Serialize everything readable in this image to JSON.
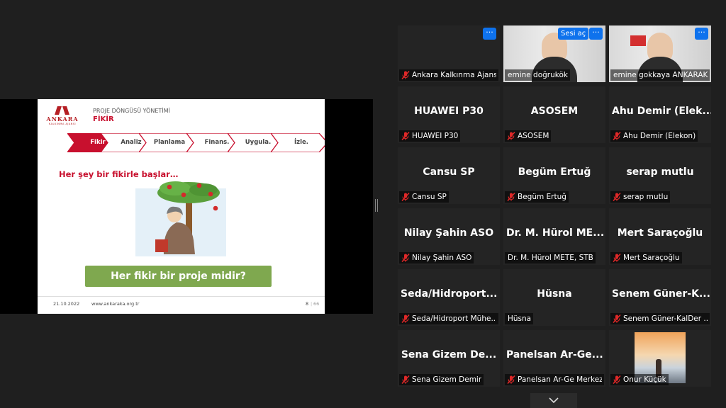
{
  "slide": {
    "logo_name": "ANKARA",
    "logo_sub": "KALKINMA AJANSI",
    "header_title": "PROJE DÖNGÜSÜ YÖNETİMİ",
    "header_subtitle": "FİKİR",
    "steps": [
      "Fikir",
      "Analiz",
      "Planlama",
      "Finans.",
      "Uygula.",
      "İzle."
    ],
    "active_step_index": 0,
    "motto": "Her şey bir fikirle başlar…",
    "question": "Her fikir bir proje midir?",
    "footer_date": "21.10.2022",
    "footer_url": "www.ankaraka.org.tr",
    "page_number": "8",
    "page_total": "66"
  },
  "participants": {
    "unmute_label": "Sesi aç",
    "more_label": "···",
    "tiles": [
      {
        "name": "Ankara Kalkınma Ajansı",
        "big": "",
        "muted": true
      },
      {
        "name": "emine doğrukök",
        "big": "",
        "muted": false,
        "video": "camera"
      },
      {
        "name": "emine gokkaya ANKARAKA",
        "big": "",
        "muted": false,
        "video": "camera",
        "active": true
      },
      {
        "name": "HUAWEI P30",
        "big": "HUAWEI P30",
        "muted": true
      },
      {
        "name": "ASOSEM",
        "big": "ASOSEM",
        "muted": true
      },
      {
        "name": "Ahu Demir (Elekon)",
        "big": "Ahu Demir (Elek...",
        "muted": true
      },
      {
        "name": "Cansu SP",
        "big": "Cansu SP",
        "muted": true
      },
      {
        "name": "Begüm Ertuğ",
        "big": "Begüm Ertuğ",
        "muted": true
      },
      {
        "name": "serap mutlu",
        "big": "serap mutlu",
        "muted": true
      },
      {
        "name": "Nilay Şahin ASO",
        "big": "Nilay Şahin ASO",
        "muted": true
      },
      {
        "name": "Dr. M. Hürol METE, STB",
        "big": "Dr. M. Hürol ME...",
        "muted": false
      },
      {
        "name": "Mert Saraçoğlu",
        "big": "Mert Saraçoğlu",
        "muted": true
      },
      {
        "name": "Seda/Hidroport Mühe...",
        "big": "Seda/Hidroport...",
        "muted": true
      },
      {
        "name": "Hüsna",
        "big": "Hüsna",
        "muted": false
      },
      {
        "name": "Senem Güner-KalDer ...",
        "big": "Senem Güner-K...",
        "muted": true
      },
      {
        "name": "Sena Gizem Demir",
        "big": "Sena Gizem De...",
        "muted": true
      },
      {
        "name": "Panelsan Ar-Ge Merkezi",
        "big": "Panelsan Ar-Ge...",
        "muted": true
      },
      {
        "name": "Onur Küçük",
        "big": "",
        "muted": true,
        "video": "landscape"
      }
    ]
  },
  "colors": {
    "brand_red": "#c8102e",
    "zoom_blue": "#0e72ed",
    "active_speaker": "#e6e06a",
    "mute_red": "#e02828",
    "question_green": "#7fa84f"
  }
}
